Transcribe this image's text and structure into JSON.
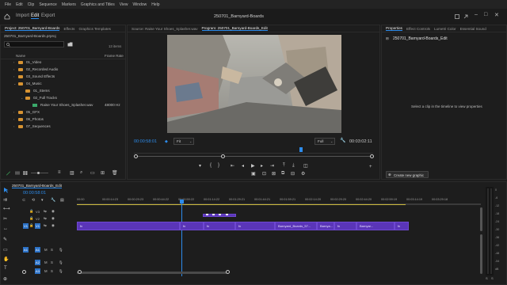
{
  "menu": [
    "File",
    "Edit",
    "Clip",
    "Sequence",
    "Markers",
    "Graphics and Titles",
    "View",
    "Window",
    "Help"
  ],
  "workspace": {
    "tabs": [
      "Import",
      "Edit",
      "Export"
    ],
    "active_tab": "Edit",
    "title": "250701_Barnyard-Boards"
  },
  "project_panel": {
    "tabs": [
      "Project: 250701_Barnyard-Boards",
      "Effects",
      "Graphics Templates"
    ],
    "file": "250701_Barnyard-Boards.prproj",
    "item_count": "13 items",
    "col_name": "Name",
    "col_rate": "Frame Rate",
    "rows": [
      {
        "label": "01_Video",
        "type": "folder",
        "indent": 0,
        "expand": "closed"
      },
      {
        "label": "02_Recorded Audio",
        "type": "folder",
        "indent": 0,
        "expand": "closed"
      },
      {
        "label": "03_Sound Effects",
        "type": "folder",
        "indent": 0,
        "expand": "closed"
      },
      {
        "label": "04_Music",
        "type": "folder",
        "indent": 0,
        "expand": "open"
      },
      {
        "label": "01_Stems",
        "type": "folder",
        "indent": 1,
        "expand": "none"
      },
      {
        "label": "02_Full Tracks",
        "type": "folder",
        "indent": 1,
        "expand": "open"
      },
      {
        "label": "Raise Your Shoes_Splasher.wav",
        "type": "wav",
        "indent": 2,
        "rate": "48000 Hz"
      },
      {
        "label": "05_GFX",
        "type": "folder",
        "indent": 0,
        "expand": "closed"
      },
      {
        "label": "06_Photos",
        "type": "folder",
        "indent": 0,
        "expand": "closed"
      },
      {
        "label": "07_Sequences",
        "type": "folder",
        "indent": 0,
        "expand": "closed"
      }
    ]
  },
  "source_tab": "Source: Raise Your Shoes_Splasher.wav",
  "program_tab": "Program: 250701_Barnyard-Boards_Edit",
  "program": {
    "timecode": "00:00:58:01",
    "fit": "Fit",
    "quality": "Full",
    "duration": "00:03:02:11"
  },
  "properties_panel": {
    "tabs": [
      "Properties",
      "Effect Controls",
      "Lumetri Color",
      "Essential Sound"
    ],
    "title": "250701_Barnyard-Boards_Edit",
    "message": "Select a clip in the timeline to view properties",
    "create_button": "Create new graphic"
  },
  "timeline": {
    "tab": "250701_Barnyard-Boards_Edit",
    "timecode": "00:00:58:01",
    "ruler": [
      "00:00",
      "00:00:14:23",
      "00:00:29:23",
      "00:00:44:22",
      "00:00:59:22",
      "00:01:14:22",
      "00:01:29:21",
      "00:01:44:21",
      "00:01:59:21",
      "00:02:14:20",
      "00:02:29:20",
      "00:02:44:20",
      "00:02:59:19",
      "00:03:14:19",
      "00:03:29:18"
    ],
    "video_tracks": [
      "V3",
      "V2",
      "V1"
    ],
    "audio_tracks": [
      "A1",
      "A2",
      "A3"
    ],
    "source_patch": [
      "V1",
      "A1"
    ],
    "clip_labels": [
      "fx",
      "fx",
      "fx",
      "fx",
      "fx",
      "fx",
      "Barnyard_Boards_57...",
      "Barnya...",
      "Barnyar..."
    ],
    "meter_labels": [
      "0",
      "-6",
      "-12",
      "-18",
      "-24",
      "-30",
      "-36",
      "-42",
      "-48",
      "-54",
      "dB"
    ]
  },
  "colors": {
    "accent": "#2d8ceb",
    "clip_video": "#5a35b8",
    "folder": "#d79332",
    "sequence": "#2f9d45",
    "audio_track": "#2c72c7"
  }
}
